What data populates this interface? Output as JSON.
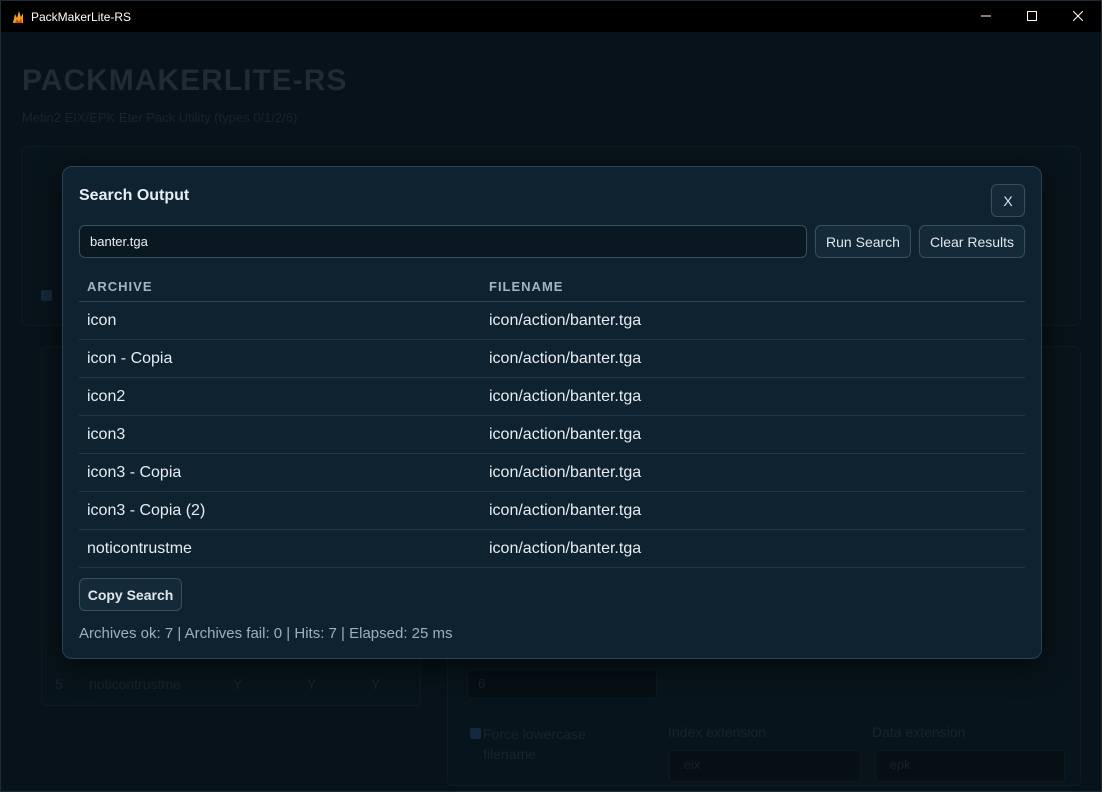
{
  "window": {
    "title": "PackMakerLite-RS"
  },
  "background": {
    "app_title": "PACKMAKERLITE-RS",
    "app_subtitle": "Metin2 EIX/EPK Eter Pack Utility (types 0/1/2/6)",
    "select_value": "6",
    "force_lowercase_label": "Force lowercase filename",
    "index_extension_label": "Index extension",
    "index_extension_value": ".eix",
    "data_extension_label": "Data extension",
    "data_extension_value": ".epk",
    "row_name": "noticontrustme",
    "row_flags": [
      "Y",
      "Y",
      "Y"
    ]
  },
  "modal": {
    "title": "Search Output",
    "close_label": "X",
    "search_value": "banter.tga",
    "run_label": "Run Search",
    "clear_label": "Clear Results",
    "columns": {
      "archive": "ARCHIVE",
      "filename": "FILENAME"
    },
    "rows": [
      {
        "archive": "icon",
        "filename": "icon/action/banter.tga"
      },
      {
        "archive": "icon - Copia",
        "filename": "icon/action/banter.tga"
      },
      {
        "archive": "icon2",
        "filename": "icon/action/banter.tga"
      },
      {
        "archive": "icon3",
        "filename": "icon/action/banter.tga"
      },
      {
        "archive": "icon3 - Copia",
        "filename": "icon/action/banter.tga"
      },
      {
        "archive": "icon3 - Copia (2)",
        "filename": "icon/action/banter.tga"
      },
      {
        "archive": "noticontrustme",
        "filename": "icon/action/banter.tga"
      }
    ],
    "copy_label": "Copy Search",
    "status": "Archives ok: 7 | Archives fail: 0 | Hits: 7 | Elapsed: 25 ms"
  },
  "colors": {
    "accent": "#1f8ad6",
    "modal_bg": "#0f2230",
    "text": "#e6edf1"
  },
  "icons": {
    "app": "flame-app-icon",
    "minimize": "minimize-icon",
    "maximize": "maximize-icon",
    "close": "close-icon"
  }
}
